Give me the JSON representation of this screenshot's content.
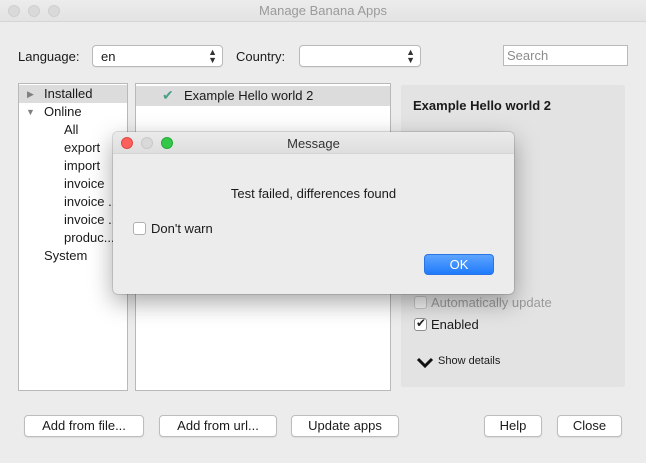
{
  "window": {
    "title": "Manage Banana Apps"
  },
  "controls": {
    "language_label": "Language:",
    "language_value": "en",
    "country_label": "Country:",
    "country_value": "",
    "search_placeholder": "Search"
  },
  "tree": {
    "installed": "Installed",
    "online": "Online",
    "children": [
      "All",
      "export",
      "import",
      "invoice",
      "invoice ...",
      "invoice ...",
      "produc..."
    ],
    "system": "System"
  },
  "apps": [
    {
      "name": "Example Hello world 2",
      "installed": true
    }
  ],
  "details": {
    "title": "Example Hello world 2",
    "auto_update_label": "Automatically update",
    "auto_update_checked": false,
    "enabled_label": "Enabled",
    "enabled_checked": true,
    "show_details_label": "Show details"
  },
  "buttons": {
    "add_from_file": "Add from file...",
    "add_from_url": "Add from url...",
    "update_apps": "Update apps",
    "help": "Help",
    "close": "Close"
  },
  "dialog": {
    "title": "Message",
    "message": "Test failed, differences found",
    "dont_warn_label": "Don't warn",
    "dont_warn_checked": false,
    "ok_label": "OK"
  },
  "colors": {
    "accent": "#1f7bfb",
    "close_light": "#fc605b",
    "minimize_light": "#d9d9d9",
    "zoom_light": "#34c84a",
    "installed_check": "#4ca08a"
  }
}
